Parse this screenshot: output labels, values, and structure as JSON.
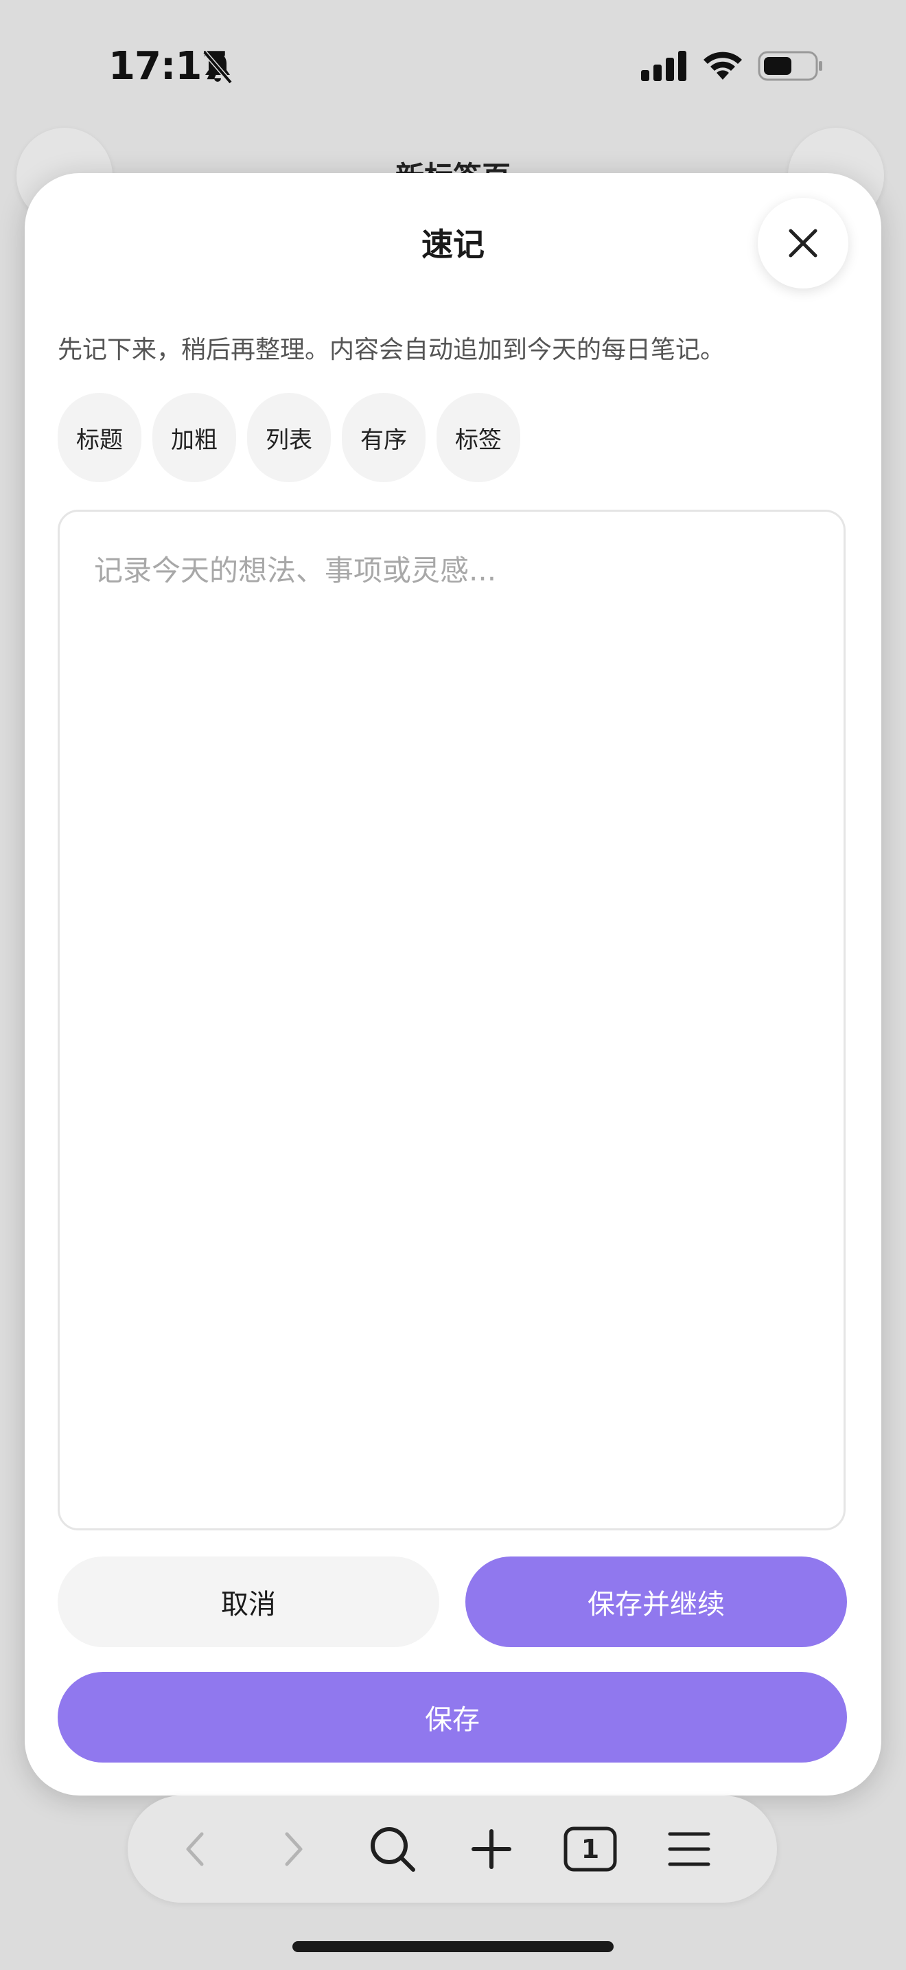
{
  "status_bar": {
    "time": "17:17",
    "icons": [
      "bell-off-icon",
      "cellular-signal-icon",
      "wifi-icon",
      "battery-icon"
    ]
  },
  "background_page": {
    "title": "新标签页"
  },
  "quick_note": {
    "title": "速记",
    "description": "先记下来，稍后再整理。内容会自动追加到今天的每日笔记。",
    "format_chips": [
      "标题",
      "加粗",
      "列表",
      "有序",
      "标签"
    ],
    "editor": {
      "value": "",
      "placeholder": "记录今天的想法、事项或灵感..."
    },
    "buttons": {
      "cancel": "取消",
      "save_and_continue": "保存并继续",
      "save": "保存"
    }
  },
  "toolbar": {
    "tab_count": "1",
    "icons": [
      "back-icon",
      "forward-icon",
      "search-icon",
      "plus-icon",
      "tabs-icon",
      "menu-icon"
    ]
  },
  "colors": {
    "accent": "#9078ee",
    "backdrop": "#dcdcdc",
    "chip_bg": "#f3f3f3"
  }
}
